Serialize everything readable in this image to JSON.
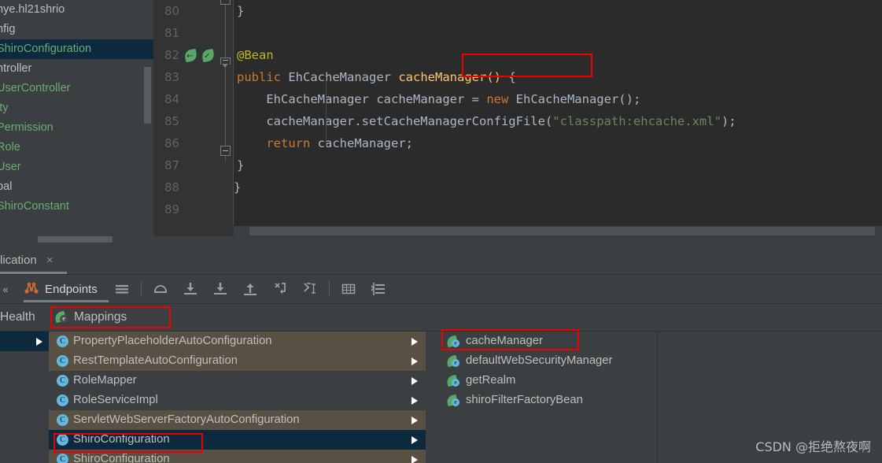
{
  "project_tree": {
    "rows": [
      {
        "label": "nye.hl21shrio",
        "kind": "pkg",
        "selected": false
      },
      {
        "label": "nfig",
        "kind": "pkg",
        "selected": false
      },
      {
        "label": "ShiroConfiguration",
        "kind": "cls",
        "selected": true
      },
      {
        "label": "ntroller",
        "kind": "pkg",
        "selected": false
      },
      {
        "label": "UserController",
        "kind": "cls",
        "selected": false
      },
      {
        "label": "ity",
        "kind": "cls",
        "selected": false
      },
      {
        "label": "Permission",
        "kind": "cls",
        "selected": false
      },
      {
        "label": "Role",
        "kind": "cls",
        "selected": false
      },
      {
        "label": "User",
        "kind": "cls",
        "selected": false
      },
      {
        "label": "bal",
        "kind": "pkg",
        "selected": false
      },
      {
        "label": "ShiroConstant",
        "kind": "cls",
        "selected": false
      }
    ]
  },
  "editor": {
    "line_numbers": [
      "80",
      "81",
      "82",
      "83",
      "84",
      "85",
      "86",
      "87",
      "88",
      "89"
    ],
    "gutter_bean_icons_on_line": "82",
    "lines": [
      {
        "num": "80",
        "text": "    }"
      },
      {
        "num": "81",
        "text": ""
      },
      {
        "num": "82",
        "text": "    @Bean"
      },
      {
        "num": "83",
        "text": "    public EhCacheManager cacheManager() {"
      },
      {
        "num": "84",
        "text": "        EhCacheManager cacheManager = new EhCacheManager();"
      },
      {
        "num": "85",
        "text": "        cacheManager.setCacheManagerConfigFile(\"classpath:ehcache.xml\");"
      },
      {
        "num": "86",
        "text": "        return cacheManager;"
      },
      {
        "num": "87",
        "text": "    }"
      },
      {
        "num": "88",
        "text": "}"
      },
      {
        "num": "89",
        "text": ""
      }
    ],
    "tokens": {
      "annotation_bean": "@Bean",
      "kw_public": "public",
      "type_ehcachemanager": "EhCacheManager",
      "method_cachemanager": "cacheManager()",
      "brace_open": " {",
      "var_cachemanager": "cacheManager",
      "eq": " = ",
      "kw_new": "new",
      "ctor_call": "EhCacheManager();",
      "setter_call": "cacheManager.setCacheManagerConfigFile(",
      "string_classpath": "\"classpath:ehcache.xml\"",
      "paren_semi": ");",
      "kw_return": "return",
      "return_value": "cacheManager;",
      "brace_close_inner": "}",
      "brace_close_outer": "}",
      "brace_close_top": "}"
    },
    "highlight_label": "cacheManager()"
  },
  "toolwindow": {
    "tab": {
      "title": "lication",
      "close": "×"
    },
    "toolbar": {
      "overflow_chevron": "«",
      "endpoints_label": "Endpoints",
      "icons": [
        {
          "name": "menu-icon",
          "glyph": "menu"
        },
        {
          "name": "step-over-icon",
          "glyph": "step-over"
        },
        {
          "name": "step-into-icon",
          "glyph": "step-into"
        },
        {
          "name": "force-step-into-icon",
          "glyph": "force-step-into"
        },
        {
          "name": "step-out-icon",
          "glyph": "step-out"
        },
        {
          "name": "run-to-cursor-icon",
          "glyph": "run-to-cursor"
        },
        {
          "name": "evaluate-expression-icon",
          "glyph": "evaluate"
        },
        {
          "name": "table-view-icon",
          "glyph": "table"
        },
        {
          "name": "sort-icon",
          "glyph": "sort"
        }
      ]
    },
    "subtabs": [
      {
        "label": "Health",
        "active": false,
        "highlighted": false
      },
      {
        "label": "Mappings",
        "active": true,
        "highlighted": true
      }
    ],
    "tree_items": [
      {
        "label": "PropertyPlaceholderAutoConfiguration",
        "style": "alt",
        "expandable": true
      },
      {
        "label": "RestTemplateAutoConfiguration",
        "style": "alt",
        "expandable": true
      },
      {
        "label": "RoleMapper",
        "style": "normal",
        "expandable": true
      },
      {
        "label": "RoleServiceImpl",
        "style": "normal",
        "expandable": true
      },
      {
        "label": "ServletWebServerFactoryAutoConfiguration",
        "style": "alt",
        "expandable": true
      },
      {
        "label": "ShiroConfiguration",
        "style": "sel",
        "expandable": true,
        "highlighted": true
      },
      {
        "label": "ShiroConfiguration",
        "style": "alt",
        "expandable": true
      }
    ],
    "beans": [
      {
        "label": "cacheManager",
        "highlighted": true
      },
      {
        "label": "defaultWebSecurityManager",
        "highlighted": false
      },
      {
        "label": "getRealm",
        "highlighted": false
      },
      {
        "label": "shiroFilterFactoryBean",
        "highlighted": false
      }
    ]
  },
  "watermark": "CSDN @拒绝熬夜啊",
  "colors": {
    "accent_red_highlight": "#ee0000",
    "selection_blue": "#0d293e",
    "alt_row": "#575043",
    "bean_green": "#59a869",
    "class_blue": "#62b8de",
    "editor_bg": "#2b2b2b",
    "panel_bg": "#3c3f41",
    "keyword_orange": "#cc7832",
    "string_green": "#6a8759",
    "annotation_yellow": "#bbb529",
    "method_yellow": "#ffc66d"
  }
}
